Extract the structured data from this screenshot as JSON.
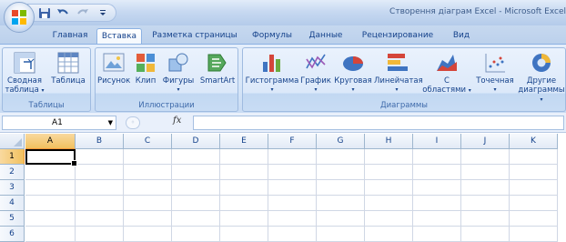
{
  "window": {
    "title": "Створення діаграм Excel - Microsoft Excel"
  },
  "quick_access": {
    "icons": [
      "save-icon",
      "undo-icon",
      "redo-icon",
      "customize-icon"
    ]
  },
  "tabs": [
    {
      "label": "Главная",
      "active": false
    },
    {
      "label": "Вставка",
      "active": true
    },
    {
      "label": "Разметка страницы",
      "active": false
    },
    {
      "label": "Формулы",
      "active": false
    },
    {
      "label": "Данные",
      "active": false
    },
    {
      "label": "Рецензирование",
      "active": false
    },
    {
      "label": "Вид",
      "active": false
    }
  ],
  "ribbon": {
    "groups": {
      "tables": {
        "label": "Таблицы",
        "pivot_line1": "Сводная",
        "pivot_line2": "таблица",
        "table": "Таблица"
      },
      "illustrations": {
        "label": "Иллюстрации",
        "picture": "Рисунок",
        "clip": "Клип",
        "shapes": "Фигуры",
        "smartart": "SmartArt"
      },
      "charts": {
        "label": "Диаграммы",
        "column": "Гистограмма",
        "line": "График",
        "pie": "Круговая",
        "bar": "Линейчатая",
        "area_line1": "С",
        "area_line2": "областями",
        "scatter": "Точечная",
        "other_line1": "Другие",
        "other_line2": "диаграммы"
      }
    }
  },
  "formula_bar": {
    "name_box": "A1",
    "fx_label": "fx",
    "formula": ""
  },
  "grid": {
    "columns": [
      "A",
      "B",
      "C",
      "D",
      "E",
      "F",
      "G",
      "H",
      "I",
      "J",
      "K"
    ],
    "rows": [
      "1",
      "2",
      "3",
      "4",
      "5",
      "6"
    ],
    "selected_cell": "A1"
  },
  "colors": {
    "accent": "#15428b",
    "selection_header": "#f1c15f"
  }
}
